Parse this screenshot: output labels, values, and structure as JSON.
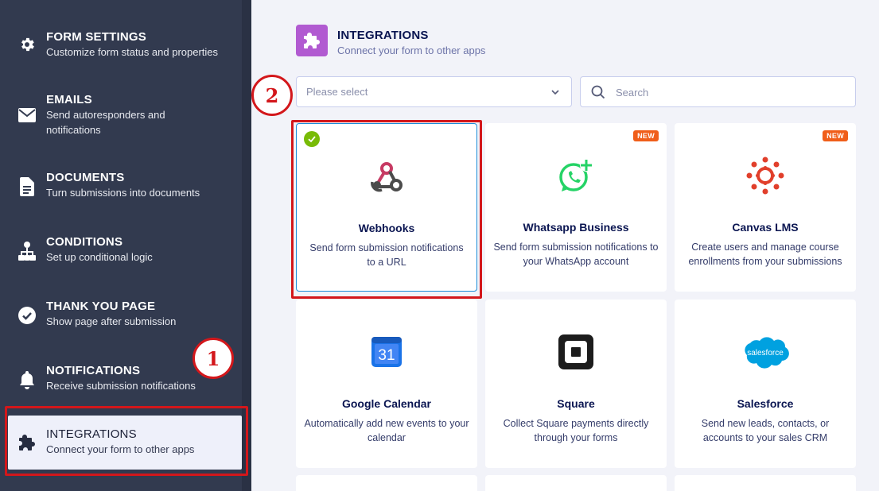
{
  "sidebar": {
    "items": [
      {
        "title": "FORM SETTINGS",
        "desc": "Customize form status and properties",
        "icon": "gear-icon"
      },
      {
        "title": "EMAILS",
        "desc": "Send autoresponders and notifications",
        "icon": "envelope-icon"
      },
      {
        "title": "DOCUMENTS",
        "desc": "Turn submissions into documents",
        "icon": "document-icon"
      },
      {
        "title": "CONDITIONS",
        "desc": "Set up conditional logic",
        "icon": "sitemap-icon"
      },
      {
        "title": "THANK YOU PAGE",
        "desc": "Show page after submission",
        "icon": "check-circle-icon"
      },
      {
        "title": "NOTIFICATIONS",
        "desc": "Receive submission notifications",
        "icon": "bell-icon"
      },
      {
        "title": "INTEGRATIONS",
        "desc": "Connect your form to other apps",
        "icon": "puzzle-icon",
        "active": true
      }
    ]
  },
  "callouts": {
    "one": "1",
    "two": "2"
  },
  "header": {
    "title": "INTEGRATIONS",
    "subtitle": "Connect your form to other apps",
    "icon": "puzzle-icon"
  },
  "filters": {
    "select_placeholder": "Please select",
    "search_placeholder": "Search"
  },
  "badge_new": "NEW",
  "cards": [
    {
      "title": "Webhooks",
      "desc": "Send form submission notifications to a URL",
      "icon": "webhook-icon",
      "selected": true
    },
    {
      "title": "Whatsapp Business",
      "desc": "Send form submission notifications to your WhatsApp account",
      "icon": "whatsapp-icon",
      "new": true
    },
    {
      "title": "Canvas LMS",
      "desc": "Create users and manage course enrollments from your submissions",
      "icon": "canvas-icon",
      "new": true
    },
    {
      "title": "Google Calendar",
      "desc": "Automatically add new events to your calendar",
      "icon": "google-calendar-icon",
      "calendar_day": "31"
    },
    {
      "title": "Square",
      "desc": "Collect Square payments directly through your forms",
      "icon": "square-icon"
    },
    {
      "title": "Salesforce",
      "desc": "Send new leads, contacts, or accounts to your sales CRM",
      "icon": "salesforce-icon",
      "logo_text": "salesforce"
    }
  ],
  "colors": {
    "sidebar": "#323a4f",
    "accent": "#b15ad1",
    "highlight": "#d3171b",
    "new_badge": "#f05e1a",
    "check": "#78bb07"
  }
}
